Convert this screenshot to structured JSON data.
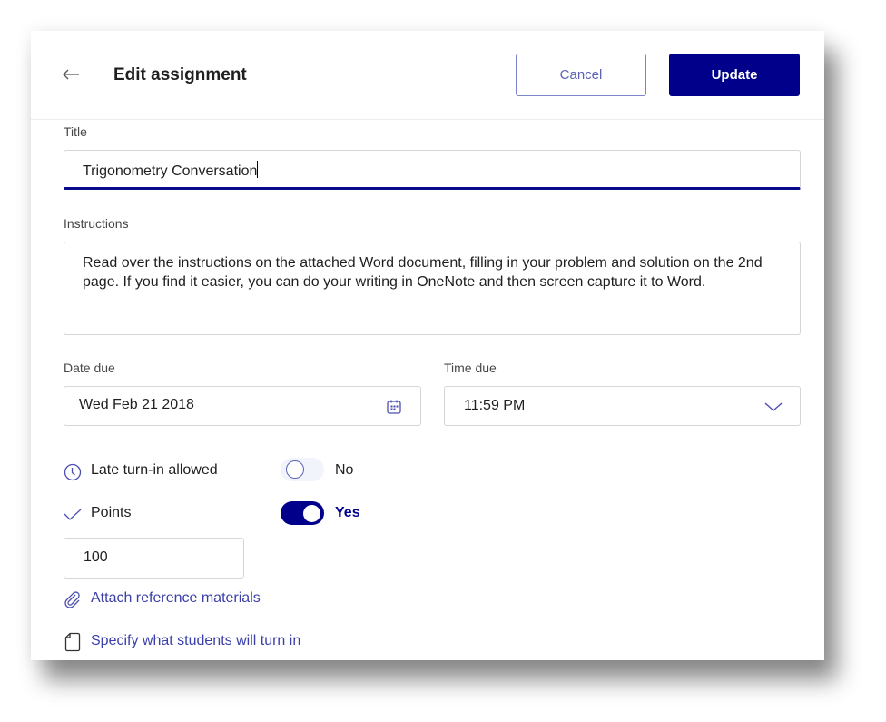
{
  "header": {
    "title": "Edit assignment",
    "back_icon": "arrow-left-icon",
    "cancel_label": "Cancel",
    "update_label": "Update"
  },
  "form": {
    "title_label": "Title",
    "title_value": "Trigonometry Conversation",
    "instructions_label": "Instructions",
    "instructions_value": "Read over the instructions on the attached Word document, filling in your problem and solution on the 2nd page.  If you find it easier, you can do your writing in OneNote and then screen capture it to Word.",
    "date_due_label": "Date due",
    "date_due_value": "Wed Feb 21 2018",
    "time_due_label": "Time due",
    "time_due_value": "11:59 PM",
    "late_turn_in": {
      "label": "Late turn-in allowed",
      "icon": "clock-icon",
      "state_label": "No",
      "enabled": false
    },
    "points": {
      "label": "Points",
      "icon": "checkmark-icon",
      "state_label": "Yes",
      "enabled": true,
      "value": "100"
    },
    "attach_link": "Attach reference materials",
    "specify_link": "Specify what students will turn in"
  },
  "colors": {
    "accent": "#00008b",
    "link": "#3b3fa8",
    "outline_button": "#7f85cc"
  }
}
